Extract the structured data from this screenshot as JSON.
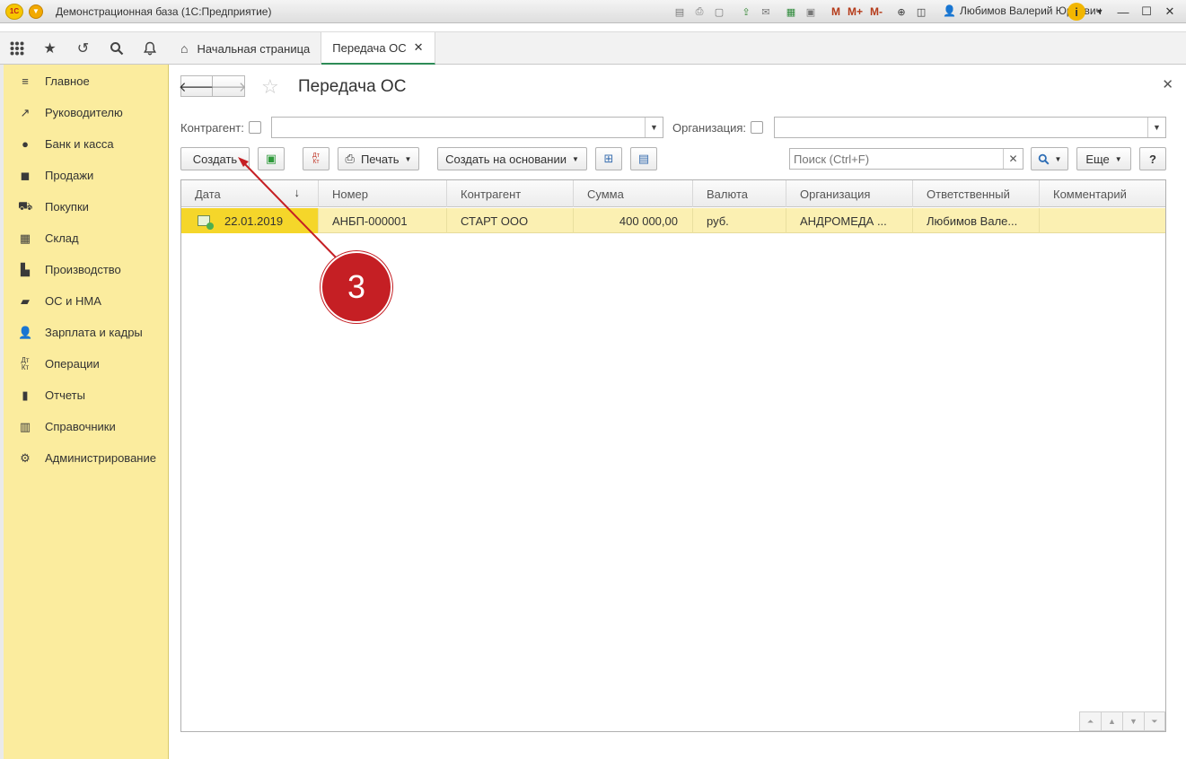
{
  "window": {
    "logo": "1С",
    "title": "Демонстрационная база  (1С:Предприятие)",
    "memory_buttons": [
      "M",
      "M+",
      "M-"
    ],
    "user": "Любимов Валерий Юрьевич"
  },
  "tabs": [
    {
      "label": "Начальная страница"
    },
    {
      "label": "Передача ОС"
    }
  ],
  "sidebar": {
    "items": [
      {
        "label": "Главное",
        "icon": "menu-lines-icon"
      },
      {
        "label": "Руководителю",
        "icon": "trend-chart-icon"
      },
      {
        "label": "Банк и касса",
        "icon": "coin-icon"
      },
      {
        "label": "Продажи",
        "icon": "shopping-bag-icon"
      },
      {
        "label": "Покупки",
        "icon": "cart-icon"
      },
      {
        "label": "Склад",
        "icon": "warehouse-icon"
      },
      {
        "label": "Производство",
        "icon": "factory-icon"
      },
      {
        "label": "ОС и НМА",
        "icon": "truck-icon"
      },
      {
        "label": "Зарплата и кадры",
        "icon": "person-icon"
      },
      {
        "label": "Операции",
        "icon": "dt-kt-icon"
      },
      {
        "label": "Отчеты",
        "icon": "bar-chart-icon"
      },
      {
        "label": "Справочники",
        "icon": "book-icon"
      },
      {
        "label": "Администрирование",
        "icon": "gear-icon"
      }
    ]
  },
  "page": {
    "title": "Передача ОС"
  },
  "filters": {
    "counterparty_label": "Контрагент:",
    "organization_label": "Организация:"
  },
  "toolbar": {
    "create_label": "Создать",
    "print_label": "Печать",
    "create_based_label": "Создать на основании",
    "search_placeholder": "Поиск (Ctrl+F)",
    "more_label": "Еще",
    "help_label": "?"
  },
  "table": {
    "columns": [
      "Дата",
      "Номер",
      "Контрагент",
      "Сумма",
      "Валюта",
      "Организация",
      "Ответственный",
      "Комментарий"
    ],
    "rows": [
      {
        "date": "22.01.2019",
        "number": "АНБП-000001",
        "counterparty": "СТАРТ ООО",
        "amount": "400 000,00",
        "currency": "руб.",
        "organization": "АНДРОМЕДА ...",
        "responsible": "Любимов Вале...",
        "comment": ""
      }
    ]
  },
  "annotation": {
    "label": "3",
    "color": "#c51f24"
  }
}
